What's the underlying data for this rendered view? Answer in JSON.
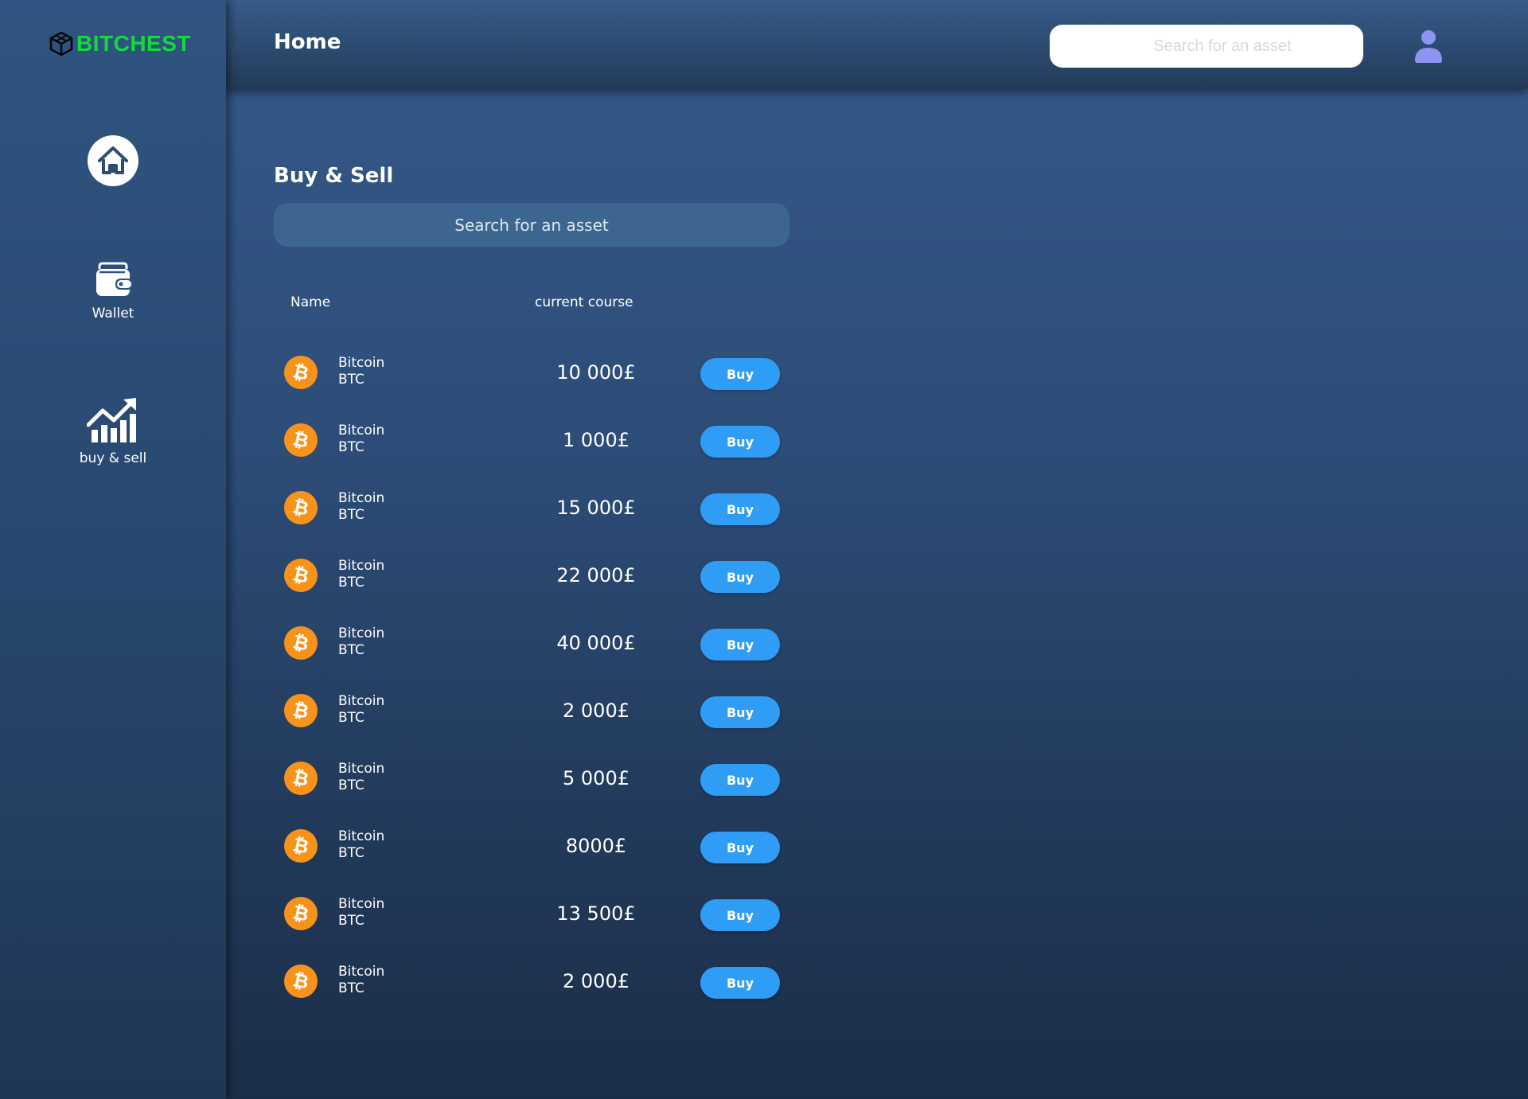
{
  "brand": {
    "name": "BITCHEST",
    "color": "#12dc3a"
  },
  "header": {
    "title": "Home",
    "search_placeholder": "Search for an asset"
  },
  "sidebar": {
    "items": [
      {
        "label": "",
        "icon": "home-icon"
      },
      {
        "label": "Wallet",
        "icon": "wallet-icon"
      },
      {
        "label": "buy & sell",
        "icon": "chart-up-icon"
      }
    ]
  },
  "main": {
    "title": "Buy & Sell",
    "search_placeholder": "Search for an asset",
    "columns": {
      "name": "Name",
      "course": "current course"
    },
    "buy_label": "Buy",
    "rows": [
      {
        "name": "Bitcoin",
        "symbol": "BTC",
        "price": "10 000£"
      },
      {
        "name": "Bitcoin",
        "symbol": "BTC",
        "price": "1 000£"
      },
      {
        "name": "Bitcoin",
        "symbol": "BTC",
        "price": "15 000£"
      },
      {
        "name": "Bitcoin",
        "symbol": "BTC",
        "price": "22 000£"
      },
      {
        "name": "Bitcoin",
        "symbol": "BTC",
        "price": "40 000£"
      },
      {
        "name": "Bitcoin",
        "symbol": "BTC",
        "price": "2 000£"
      },
      {
        "name": "Bitcoin",
        "symbol": "BTC",
        "price": "5 000£"
      },
      {
        "name": "Bitcoin",
        "symbol": "BTC",
        "price": "8000£"
      },
      {
        "name": "Bitcoin",
        "symbol": "BTC",
        "price": "13 500£"
      },
      {
        "name": "Bitcoin",
        "symbol": "BTC",
        "price": "2 000£"
      }
    ]
  },
  "colors": {
    "accent": "#2f9cf5",
    "bitcoin": "#f7931a",
    "user_icon": "#8f93f2"
  }
}
